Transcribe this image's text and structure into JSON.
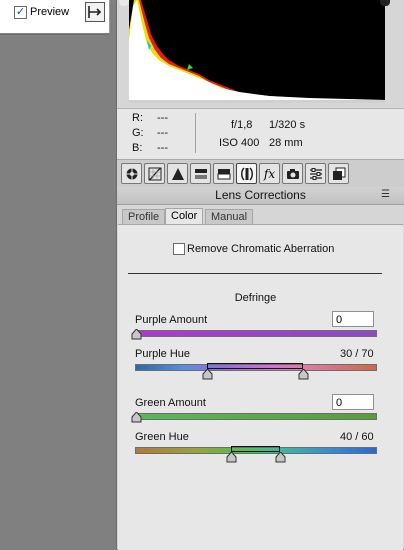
{
  "left": {
    "preview_label": "Preview",
    "preview_checked": "✓"
  },
  "histogram_info": {
    "r_label": "R:",
    "r_value": "---",
    "g_label": "G:",
    "g_value": "---",
    "b_label": "B:",
    "b_value": "---",
    "aperture": "f/1,8",
    "shutter": "1/320 s",
    "iso": "ISO 400",
    "focal_length": "28 mm"
  },
  "toolbar": {
    "tools": [
      "basic-icon",
      "tone-curve-icon",
      "detail-icon",
      "hsl-icon",
      "split-toning-icon",
      "lens-corrections-icon",
      "effects-icon",
      "camera-calibration-icon",
      "presets-icon",
      "snapshots-icon"
    ]
  },
  "panel": {
    "title": "Lens Corrections",
    "menu_glyph": "☰"
  },
  "tabs": [
    {
      "label": "Profile"
    },
    {
      "label": "Color"
    },
    {
      "label": "Manual"
    }
  ],
  "color_tab": {
    "remove_ca_label": "Remove Chromatic Aberration",
    "defringe_title": "Defringe",
    "purple_amount_label": "Purple Amount",
    "purple_amount_value": "0",
    "purple_hue_label": "Purple Hue",
    "purple_hue_value": "30 / 70",
    "green_amount_label": "Green Amount",
    "green_amount_value": "0",
    "green_hue_label": "Green Hue",
    "green_hue_value": "40 / 60"
  },
  "colors": {
    "purple": "#9b3fc0",
    "green": "#55b84a",
    "panel_bg": "#e7e7e7"
  }
}
